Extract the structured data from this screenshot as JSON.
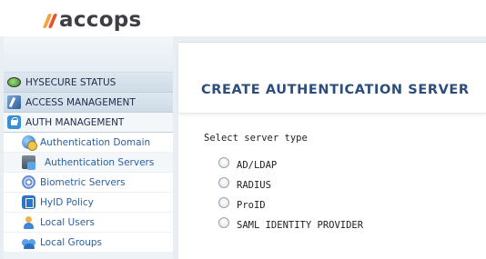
{
  "brand": {
    "logo_text": "accops"
  },
  "sidebar": {
    "sections": [
      {
        "label": "HYSECURE STATUS",
        "icon": "status-icon"
      },
      {
        "label": "ACCESS MANAGEMENT",
        "icon": "access-management-icon"
      },
      {
        "label": "AUTH MANAGEMENT",
        "icon": "auth-management-icon"
      }
    ],
    "items": [
      {
        "label": "Authentication Domain",
        "icon": "globe-icon"
      },
      {
        "label": "Authentication Servers",
        "icon": "server-icon",
        "selected": true
      },
      {
        "label": "Biometric Servers",
        "icon": "fingerprint-icon"
      },
      {
        "label": "HyID Policy",
        "icon": "hyid-icon"
      },
      {
        "label": "Local Users",
        "icon": "user-icon"
      },
      {
        "label": "Local Groups",
        "icon": "group-icon"
      }
    ]
  },
  "main": {
    "title": "CREATE AUTHENTICATION SERVER",
    "server_type_label": "Select server type",
    "server_types": [
      "AD/LDAP",
      "RADIUS",
      "ProID",
      "SAML IDENTITY PROVIDER"
    ]
  },
  "colors": {
    "accent": "#2c4d7e",
    "link": "#2b5fa0",
    "logo_orange": "#f6a13a",
    "logo_red": "#e8552b"
  }
}
